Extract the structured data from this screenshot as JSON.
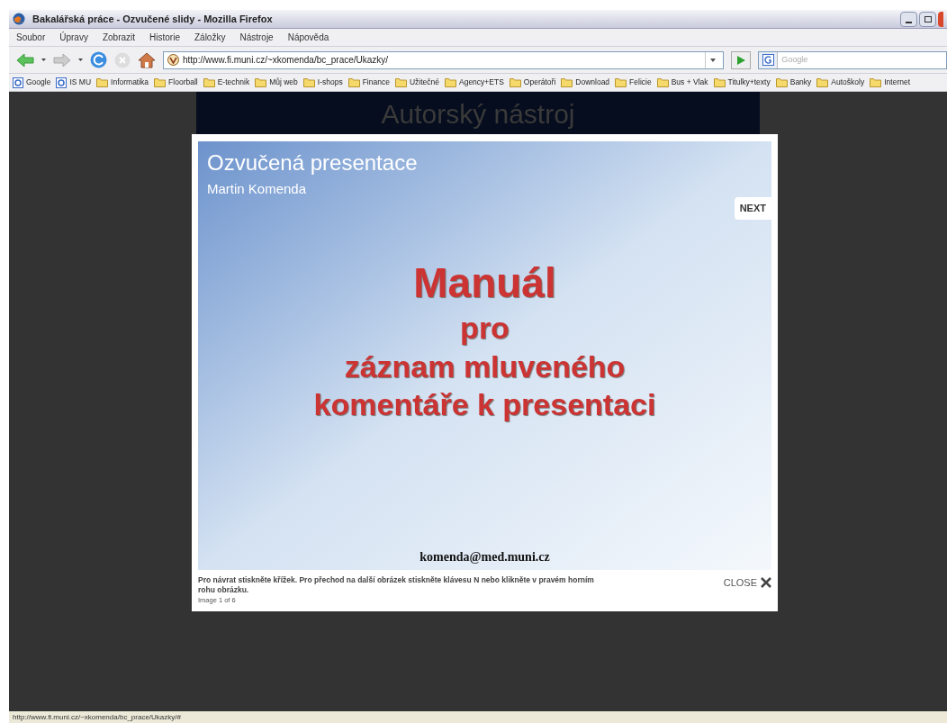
{
  "window": {
    "title": "Bakalářská práce - Ozvučené slidy - Mozilla Firefox"
  },
  "menu": [
    "Soubor",
    "Úpravy",
    "Zobrazit",
    "Historie",
    "Záložky",
    "Nástroje",
    "Nápověda"
  ],
  "address_bar": {
    "value": "http://www.fi.muni.cz/~xkomenda/bc_prace/Ukazky/"
  },
  "search": {
    "placeholder": "Google"
  },
  "bookmarks": [
    {
      "label": "Google",
      "kind": "site"
    },
    {
      "label": "IS MU",
      "kind": "site"
    },
    {
      "label": "Informatika",
      "kind": "folder"
    },
    {
      "label": "Floorball",
      "kind": "folder"
    },
    {
      "label": "E-technik",
      "kind": "folder"
    },
    {
      "label": "Můj web",
      "kind": "folder"
    },
    {
      "label": "I-shops",
      "kind": "folder"
    },
    {
      "label": "Finance",
      "kind": "folder"
    },
    {
      "label": "Užitečné",
      "kind": "folder"
    },
    {
      "label": "Agency+ETS",
      "kind": "folder"
    },
    {
      "label": "Operátoři",
      "kind": "folder"
    },
    {
      "label": "Download",
      "kind": "folder"
    },
    {
      "label": "Felicie",
      "kind": "folder"
    },
    {
      "label": "Bus + Vlak",
      "kind": "folder"
    },
    {
      "label": "Titulky+texty",
      "kind": "folder"
    },
    {
      "label": "Banky",
      "kind": "folder"
    },
    {
      "label": "Autoškoly",
      "kind": "folder"
    },
    {
      "label": "Internet",
      "kind": "folder"
    }
  ],
  "page": {
    "background_heading": "Autorský nástroj"
  },
  "lightbox": {
    "slide": {
      "title": "Ozvučená presentace",
      "author": "Martin Komenda",
      "lines": [
        "Manuál",
        "pro",
        "záznam mluveného",
        "komentáře k presentaci"
      ],
      "email": "komenda@med.muni.cz"
    },
    "next": "NEXT",
    "caption": "Pro návrat stiskněte křížek. Pro přechod na další obrázek stiskněte klávesu N nebo klikněte v pravém horním rohu obrázku.",
    "counter": "Image 1 of 6",
    "close": "CLOSE"
  },
  "status_bar": "http://www.fi.muni.cz/~xkomenda/bc_prace/Ukazky/#"
}
